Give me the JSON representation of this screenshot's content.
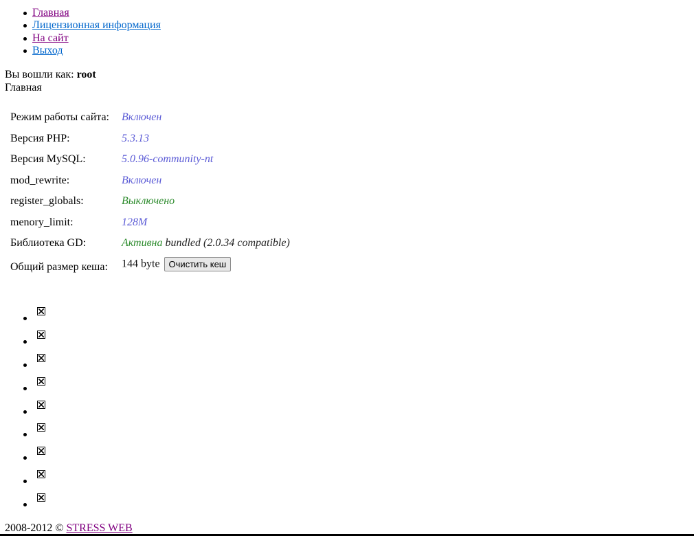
{
  "nav": [
    {
      "label": "Главная",
      "state": "visited"
    },
    {
      "label": "Лицензионная информация",
      "state": "link"
    },
    {
      "label": "На сайт",
      "state": "visited"
    },
    {
      "label": "Выход",
      "state": "link"
    }
  ],
  "session": {
    "prefix": "Вы вошли как: ",
    "user": "root"
  },
  "breadcrumb": "Главная",
  "info": {
    "site_mode": {
      "label": "Режим работы сайта:",
      "value": "Включен"
    },
    "php": {
      "label": "Версия PHP:",
      "value": "5.3.13"
    },
    "mysql": {
      "label": "Версия MySQL:",
      "value": "5.0.96-community-nt"
    },
    "mod_rewrite": {
      "label": "mod_rewrite:",
      "value": "Включен"
    },
    "register_globals": {
      "label": "register_globals:",
      "value": "Выключено"
    },
    "memory_limit": {
      "label": "menory_limit:",
      "value": "128M"
    },
    "gd": {
      "label": "Библиотека GD:",
      "status": "Активна",
      "detail": " bundled (2.0.34 compatible)"
    },
    "cache": {
      "label": "Общий размер кеша:",
      "value": "144 byte ",
      "button": "Очистить кеш"
    }
  },
  "colors": {
    "blue_value": "#5b5bd6",
    "green_value": "#2b8a2b",
    "visited_link": "#800080",
    "link": "#0066cc"
  },
  "icons": [
    "broken-image-icon",
    "broken-image-icon",
    "broken-image-icon",
    "broken-image-icon",
    "broken-image-icon",
    "broken-image-icon",
    "broken-image-icon",
    "broken-image-icon",
    "broken-image-icon"
  ],
  "footer": {
    "text": "2008-2012 © ",
    "link": "STRESS WEB"
  }
}
